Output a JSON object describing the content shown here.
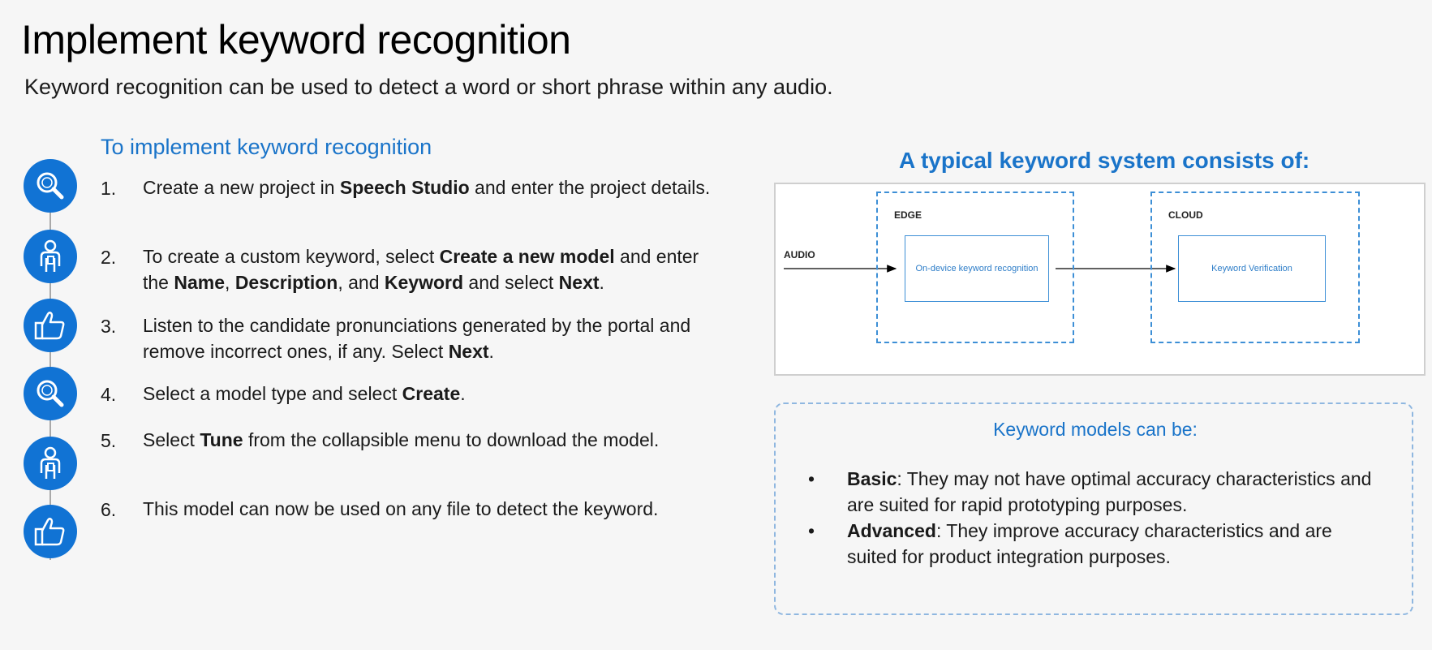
{
  "title": "Implement keyword recognition",
  "subtitle": "Keyword recognition can be used to detect a word or short phrase within any audio.",
  "steps_heading": "To implement keyword recognition",
  "steps": [
    {
      "num": "1.",
      "icon": "magnifier-icon",
      "parts": [
        {
          "text": "Create a new project in ",
          "bold": false
        },
        {
          "text": "Speech Studio",
          "bold": true
        },
        {
          "text": " and enter the project details.",
          "bold": false
        }
      ]
    },
    {
      "num": "2.",
      "icon": "person-icon",
      "parts": [
        {
          "text": "To create a custom keyword, select ",
          "bold": false
        },
        {
          "text": "Create a new model",
          "bold": true
        },
        {
          "text": " and enter the ",
          "bold": false
        },
        {
          "text": "Name",
          "bold": true
        },
        {
          "text": ", ",
          "bold": false
        },
        {
          "text": "Description",
          "bold": true
        },
        {
          "text": ", and ",
          "bold": false
        },
        {
          "text": "Keyword",
          "bold": true
        },
        {
          "text": " and select ",
          "bold": false
        },
        {
          "text": "Next",
          "bold": true
        },
        {
          "text": ".",
          "bold": false
        }
      ]
    },
    {
      "num": "3.",
      "icon": "thumbs-up-icon",
      "parts": [
        {
          "text": "Listen to the candidate pronunciations generated by the portal and remove incorrect ones, if any. Select ",
          "bold": false
        },
        {
          "text": "Next",
          "bold": true
        },
        {
          "text": ".",
          "bold": false
        }
      ]
    },
    {
      "num": "4.",
      "icon": "magnifier-icon",
      "parts": [
        {
          "text": "Select a model type and select ",
          "bold": false
        },
        {
          "text": "Create",
          "bold": true
        },
        {
          "text": ".",
          "bold": false
        }
      ]
    },
    {
      "num": "5.",
      "icon": "person-icon",
      "parts": [
        {
          "text": "Select ",
          "bold": false
        },
        {
          "text": "Tune",
          "bold": true
        },
        {
          "text": " from the collapsible menu to download the model.",
          "bold": false
        }
      ]
    },
    {
      "num": "6.",
      "icon": "thumbs-up-icon",
      "parts": [
        {
          "text": "This model can now be used on any file to detect the keyword.",
          "bold": false
        }
      ]
    }
  ],
  "diagram": {
    "heading": "A typical keyword system consists of:",
    "audio_label": "AUDIO",
    "edge_label": "EDGE",
    "cloud_label": "CLOUD",
    "edge_box": "On-device keyword recognition",
    "cloud_box": "Keyword Verification"
  },
  "models": {
    "heading": "Keyword models can be:",
    "bullet": "•",
    "items": [
      {
        "term": "Basic",
        "desc": ": They may not have optimal accuracy characteristics and are suited for rapid prototyping purposes."
      },
      {
        "term": "Advanced",
        "desc": ": They improve accuracy characteristics and are suited for product integration purposes."
      }
    ]
  },
  "colors": {
    "accent": "#1a74c9",
    "icon_bg": "#1173d4",
    "dash": "#3d8fd6"
  }
}
